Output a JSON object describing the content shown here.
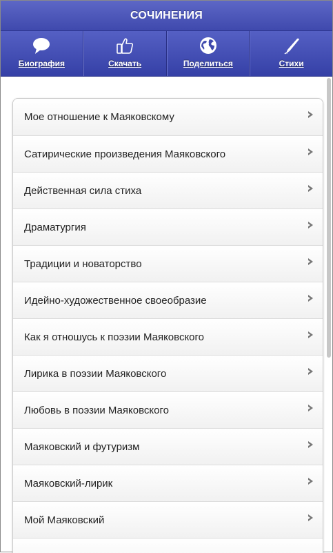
{
  "header": {
    "title": "СОЧИНЕНИЯ"
  },
  "nav": [
    {
      "label": "Биография",
      "icon": "speech-bubble-icon"
    },
    {
      "label": "Скачать",
      "icon": "thumbs-up-icon"
    },
    {
      "label": "Поделиться",
      "icon": "globe-icon"
    },
    {
      "label": "Стихи",
      "icon": "pen-icon"
    }
  ],
  "list": {
    "items": [
      "Мое отношение к Маяковскому",
      "Сатирические произведения Маяковского",
      "Действенная сила стиха",
      "Драматургия",
      "Традиции и новаторство",
      "Идейно-художественное своеобразие",
      "Как я отношусь к поэзии Маяковского",
      "Лирика в поэзии Маяковского",
      "Любовь в поэзии Маяковского",
      "Маяковский и футуризм",
      "Маяковский-лирик",
      "Мой Маяковский",
      ""
    ]
  },
  "colors": {
    "header": "#4b55b9",
    "nav": "#4550b4",
    "accent_text": "#ffffff"
  }
}
